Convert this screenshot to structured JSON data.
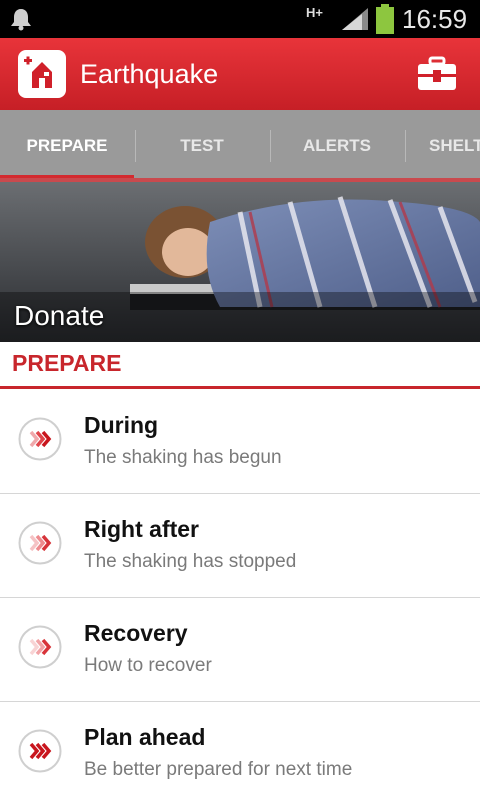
{
  "status_bar": {
    "network": "H+",
    "time": "16:59"
  },
  "app": {
    "title": "Earthquake"
  },
  "tabs": [
    {
      "label": "PREPARE",
      "active": true
    },
    {
      "label": "TEST",
      "active": false
    },
    {
      "label": "ALERTS",
      "active": false
    },
    {
      "label": "SHELT",
      "active": false
    }
  ],
  "banner": {
    "label": "Donate"
  },
  "section": {
    "title": "PREPARE"
  },
  "items": [
    {
      "title": "During",
      "subtitle": "The shaking has begun"
    },
    {
      "title": "Right after",
      "subtitle": "The shaking has stopped"
    },
    {
      "title": "Recovery",
      "subtitle": "How to recover"
    },
    {
      "title": "Plan ahead",
      "subtitle": "Be better prepared for next time"
    }
  ],
  "colors": {
    "accent": "#c8262c",
    "tab_bar": "#9a9a9a",
    "chevron": "#d0202a"
  },
  "icons": {
    "notification": "bell-icon",
    "signal": "signal-icon",
    "battery": "battery-icon",
    "app": "house-cross-icon",
    "kit": "first-aid-kit-icon",
    "list": "chevron-double-right-icon"
  }
}
